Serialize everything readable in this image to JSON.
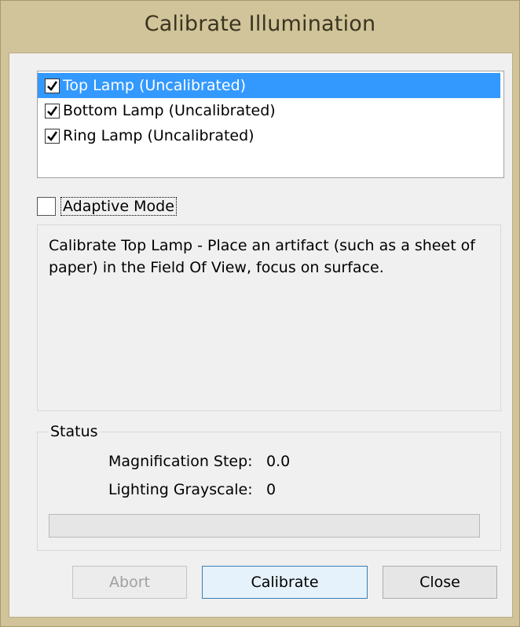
{
  "window": {
    "title": "Calibrate Illumination"
  },
  "lamps": [
    {
      "label": "Top Lamp (Uncalibrated)",
      "checked": true,
      "selected": true
    },
    {
      "label": "Bottom Lamp (Uncalibrated)",
      "checked": true,
      "selected": false
    },
    {
      "label": "Ring Lamp (Uncalibrated)",
      "checked": true,
      "selected": false
    }
  ],
  "adaptive_mode": {
    "label": "Adaptive Mode",
    "checked": false
  },
  "instructions": "Calibrate Top Lamp - Place an artifact (such as a sheet of paper) in the Field Of View, focus on surface.",
  "status": {
    "legend": "Status",
    "magnification_label": "Magnification Step:",
    "magnification_value": "0.0",
    "grayscale_label": "Lighting Grayscale:",
    "grayscale_value": "0",
    "progress": 0
  },
  "buttons": {
    "abort": "Abort",
    "calibrate": "Calibrate",
    "close": "Close"
  },
  "colors": {
    "selection": "#3399ff",
    "title_bar": "#d1c49a"
  }
}
